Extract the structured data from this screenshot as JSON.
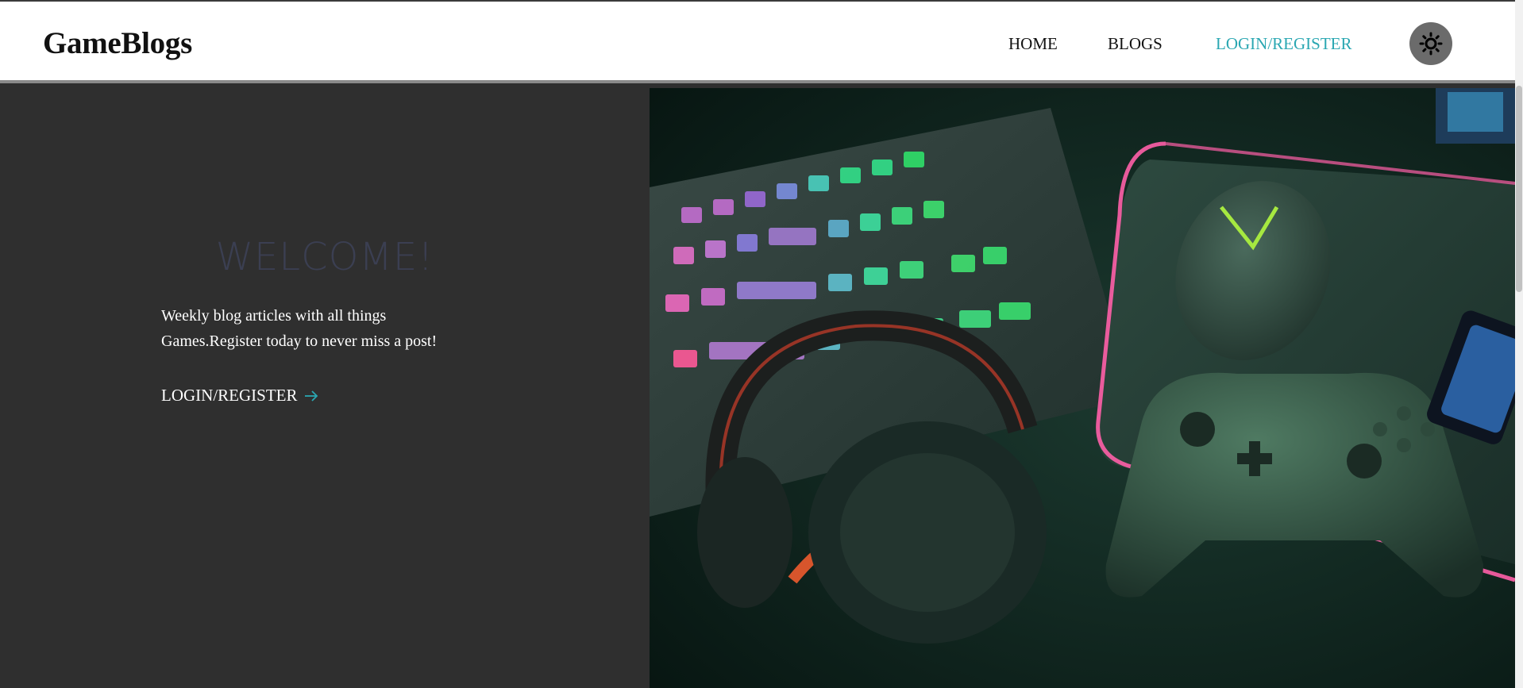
{
  "header": {
    "brand": "GameBlogs",
    "nav": {
      "home": "HOME",
      "blogs": "BLOGS",
      "login": "LOGIN/REGISTER"
    },
    "theme_toggle_icon": "sun-icon"
  },
  "hero": {
    "welcome": "WELCOME!",
    "tagline_line1": "Weekly blog articles with all things",
    "tagline_line2": "Games.Register today to never miss a post!",
    "cta_label": "LOGIN/REGISTER",
    "cta_icon": "arrow-right-icon",
    "image_description": "gaming-setup-image"
  },
  "colors": {
    "accent": "#2aa7b2",
    "background": "#2f2f2f",
    "navbar": "#ffffff"
  }
}
